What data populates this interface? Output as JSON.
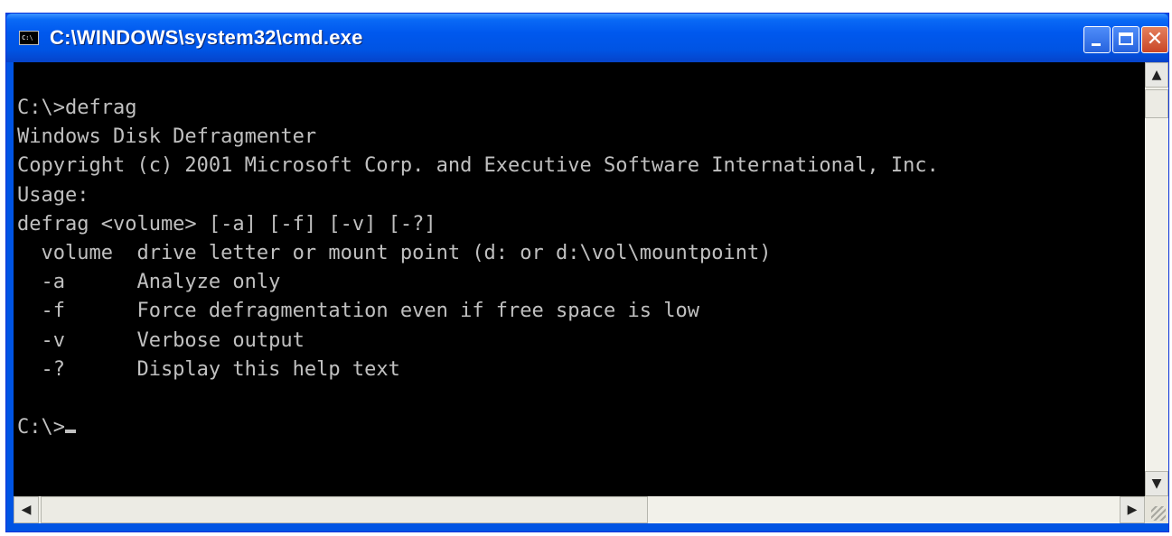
{
  "window": {
    "title": "C:\\WINDOWS\\system32\\cmd.exe",
    "app_icon_text": "C:\\",
    "controls": {
      "minimize": "minimize",
      "maximize": "maximize",
      "close": "✕"
    }
  },
  "console": {
    "lines": [
      "C:\\>defrag",
      "Windows Disk Defragmenter",
      "Copyright (c) 2001 Microsoft Corp. and Executive Software International, Inc.",
      "Usage:",
      "defrag <volume> [-a] [-f] [-v] [-?]",
      "  volume  drive letter or mount point (d: or d:\\vol\\mountpoint)",
      "  -a      Analyze only",
      "  -f      Force defragmentation even if free space is low",
      "  -v      Verbose output",
      "  -?      Display this help text",
      "",
      "C:\\>"
    ]
  },
  "scrollbars": {
    "up_arrow": "▲",
    "down_arrow": "▼",
    "left_arrow": "◀",
    "right_arrow": "▶"
  },
  "colors": {
    "titlebar": "#0054e3",
    "console_bg": "#000000",
    "console_fg": "#c0c0c0"
  }
}
